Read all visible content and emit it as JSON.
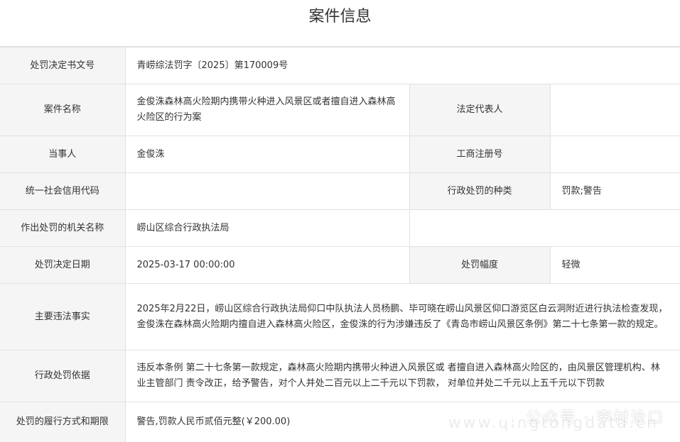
{
  "title": "案件信息",
  "rows": {
    "decision_no": {
      "label": "处罚决定书文号",
      "value": "青崂综法罚字〔2025〕第170009号"
    },
    "case_name": {
      "label": "案件名称",
      "value": "金俊洙森林高火险期内携带火种进入风景区或者擅自进入森林高火险区的行为案"
    },
    "legal_rep": {
      "label": "法定代表人",
      "value": ""
    },
    "party": {
      "label": "当事人",
      "value": "金俊洙"
    },
    "biz_reg_no": {
      "label": "工商注册号",
      "value": ""
    },
    "credit_code": {
      "label": "统一社会信用代码",
      "value": ""
    },
    "penalty_type": {
      "label": "行政处罚的种类",
      "value": "罚款;警告"
    },
    "authority": {
      "label": "作出处罚的机关名称",
      "value": "崂山区综合行政执法局"
    },
    "decision_date": {
      "label": "处罚决定日期",
      "value": "2025-03-17 00:00:00"
    },
    "penalty_degree": {
      "label": "处罚幅度",
      "value": "轻微"
    },
    "facts": {
      "label": "主要违法事实",
      "value": "2025年2月22日，崂山区综合行政执法局仰口中队执法人员杨鹏、毕可晓在崂山风景区仰口游览区白云洞附近进行执法检查发现，金俊洙在森林高火险期内擅自进入森林高火险区，金俊洙的行为涉嫌违反了《青岛市崂山风景区条例》第二十七条第一款的规定。"
    },
    "basis": {
      "label": "行政处罚依据",
      "value": "违反本条例 第二十七条第一款规定，森林高火险期内携带火种进入风景区或 者擅自进入森林高火险区的，由风景区管理机构、林业主管部门 责令改正，给予警告，对个人并处二百元以上二千元以下罚款， 对单位并处二千元以上五千元以下罚款"
    },
    "execution": {
      "label": "处罚的履行方式和期限",
      "value": "警告,罚款人民币贰佰元整(￥200.00)"
    }
  },
  "watermark": {
    "text": "公众号 · 李村沧口",
    "url_text": "www.qingtongdata.cn",
    "icon": "wechat-icon"
  }
}
